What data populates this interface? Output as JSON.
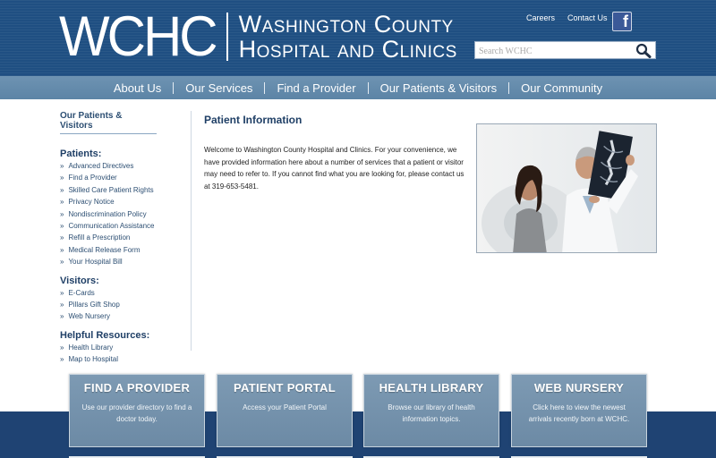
{
  "header": {
    "logo_mark": "WCHC",
    "logo_line1": "Washington County",
    "logo_line2": "Hospital and Clinics",
    "top_links": [
      "Careers",
      "Contact Us"
    ],
    "facebook_icon": "facebook-icon",
    "search_placeholder": "Search WCHC",
    "search_icon": "search-icon"
  },
  "nav": {
    "items": [
      "About Us",
      "Our Services",
      "Find a Provider",
      "Our Patients & Visitors",
      "Our Community"
    ]
  },
  "sidebar": {
    "title": "Our Patients & Visitors",
    "sections": [
      {
        "heading": "Patients:",
        "items": [
          "Advanced Directives",
          "Find a Provider",
          "Skilled Care Patient Rights",
          "Privacy Notice",
          "Nondiscrimination Policy",
          "Communication Assistance",
          "Refill a Prescription",
          "Medical Release Form",
          "Your Hospital Bill"
        ]
      },
      {
        "heading": "Visitors:",
        "items": [
          "E-Cards",
          "Pillars Gift Shop",
          "Web Nursery"
        ]
      },
      {
        "heading": "Helpful Resources:",
        "items": [
          "Health Library",
          "Map to Hospital"
        ]
      }
    ]
  },
  "main": {
    "title": "Patient Information",
    "intro": "Welcome to Washington County Hospital and Clinics. For your convenience, we have provided information here about a number of services that a patient or visitor may need to refer to. If you cannot find what you are looking for, please contact us at 319-653-5481."
  },
  "cards": [
    {
      "title": "FIND A PROVIDER",
      "desc": "Use our provider directory to find a doctor today."
    },
    {
      "title": "PATIENT PORTAL",
      "desc": "Access your Patient Portal"
    },
    {
      "title": "HEALTH LIBRARY",
      "desc": "Browse our library of health information topics."
    },
    {
      "title": "WEB NURSERY",
      "desc": "Click here to view the newest arrivals recently born at WCHC."
    }
  ],
  "colors": {
    "header_bg": "#1f4f82",
    "nav_bg": "#6b90b0",
    "accent_text": "#1f3f66",
    "card_bg": "#7694ae",
    "bottom_band": "#1f4373"
  }
}
